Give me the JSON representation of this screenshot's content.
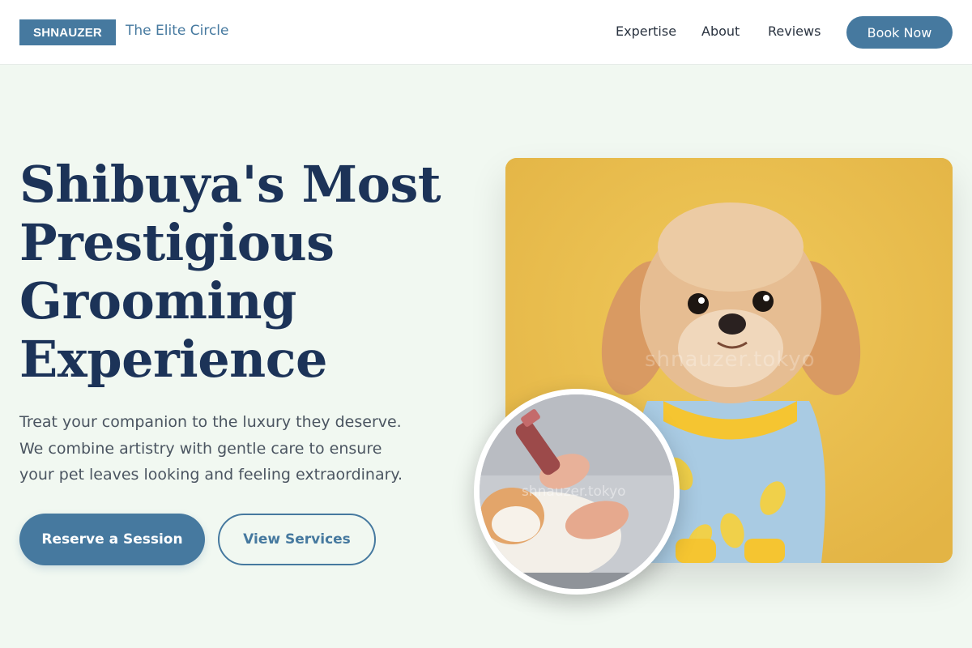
{
  "header": {
    "brand": "SHNAUZER",
    "tagline": "The Elite Circle",
    "nav": [
      "Expertise",
      "About",
      "Reviews"
    ],
    "cta": "Book Now"
  },
  "hero": {
    "headline_lines": [
      "Shibuya's Most",
      "Prestigious",
      "Grooming",
      "Experience"
    ],
    "subtext_lines": [
      "Treat your companion to the luxury they deserve.",
      "We combine artistry with gentle care to ensure",
      "your pet leaves looking and feeling extraordinary."
    ],
    "primary_button": "Reserve a Session",
    "secondary_button": "View Services"
  },
  "images": {
    "main_watermark": "shnauzer.tokyo",
    "circle_watermark": "shnauzer.tokyo"
  },
  "colors": {
    "accent": "#46799f",
    "headline": "#1c3358",
    "background": "#f1f8f1",
    "photo_background": "#e9bd4c"
  }
}
